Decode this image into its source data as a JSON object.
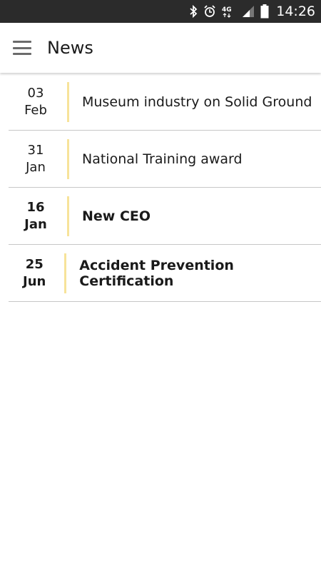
{
  "status_bar": {
    "time": "14:26",
    "network": "4G",
    "icons": [
      "bluetooth-icon",
      "alarm-icon",
      "network-4g-icon",
      "signal-icon",
      "battery-icon"
    ]
  },
  "app_bar": {
    "title": "News",
    "menu_icon": "hamburger-menu-icon"
  },
  "news": [
    {
      "day": "03",
      "month": "Feb",
      "title": "Museum industry on Solid Ground",
      "unread": false
    },
    {
      "day": "31",
      "month": "Jan",
      "title": "National Training award",
      "unread": false
    },
    {
      "day": "16",
      "month": "Jan",
      "title": "New CEO",
      "unread": true
    },
    {
      "day": "25",
      "month": "Jun",
      "title": "Accident Prevention Certification",
      "unread": true
    }
  ],
  "colors": {
    "status_bar_bg": "#2b2b2b",
    "accent_divider": "#f7e39a",
    "row_separator": "#c7c7c7"
  }
}
